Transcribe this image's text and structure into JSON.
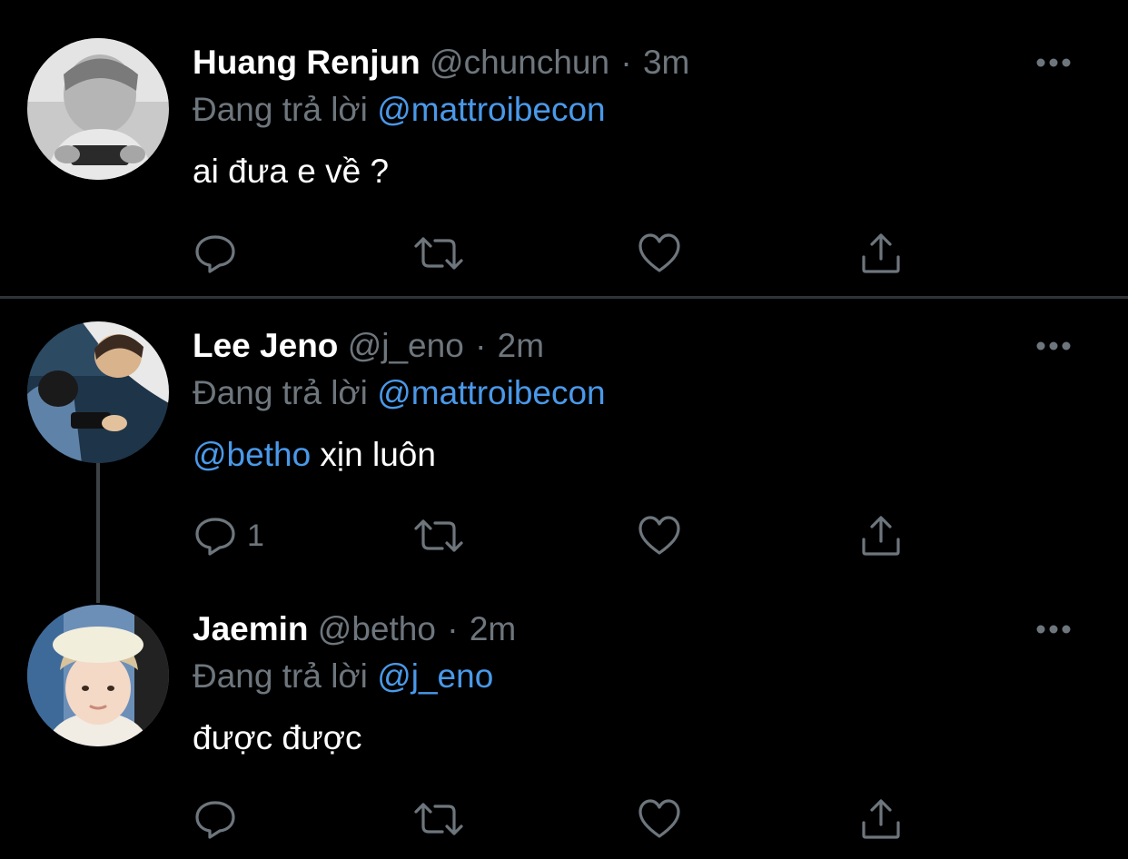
{
  "colors": {
    "background": "#000000",
    "name": "#ffffff",
    "secondary": "#6e767d",
    "link": "#4a99e9",
    "divider": "#2f3336"
  },
  "separator": "·",
  "tweets": [
    {
      "name": "Huang Renjun",
      "handle": "@chunchun",
      "time": "3m",
      "reply_prefix": "Đang trả lời",
      "reply_to": "@mattroibecon",
      "mention": "",
      "text": "ai đưa e về ?",
      "reply_count": "",
      "avatar": "avatar-renjun"
    },
    {
      "name": "Lee Jeno",
      "handle": "@j_eno",
      "time": "2m",
      "reply_prefix": "Đang trả lời",
      "reply_to": "@mattroibecon",
      "mention": "@betho",
      "text": " xịn luôn",
      "reply_count": "1",
      "avatar": "avatar-jeno"
    },
    {
      "name": "Jaemin",
      "handle": "@betho",
      "time": "2m",
      "reply_prefix": "Đang trả lời",
      "reply_to": "@j_eno",
      "mention": "",
      "text": "được được",
      "reply_count": "",
      "avatar": "avatar-jaemin"
    }
  ],
  "icons": {
    "more": "more-horizontal-icon",
    "reply": "reply-bubble-icon",
    "retweet": "retweet-icon",
    "like": "heart-icon",
    "share": "share-icon"
  }
}
